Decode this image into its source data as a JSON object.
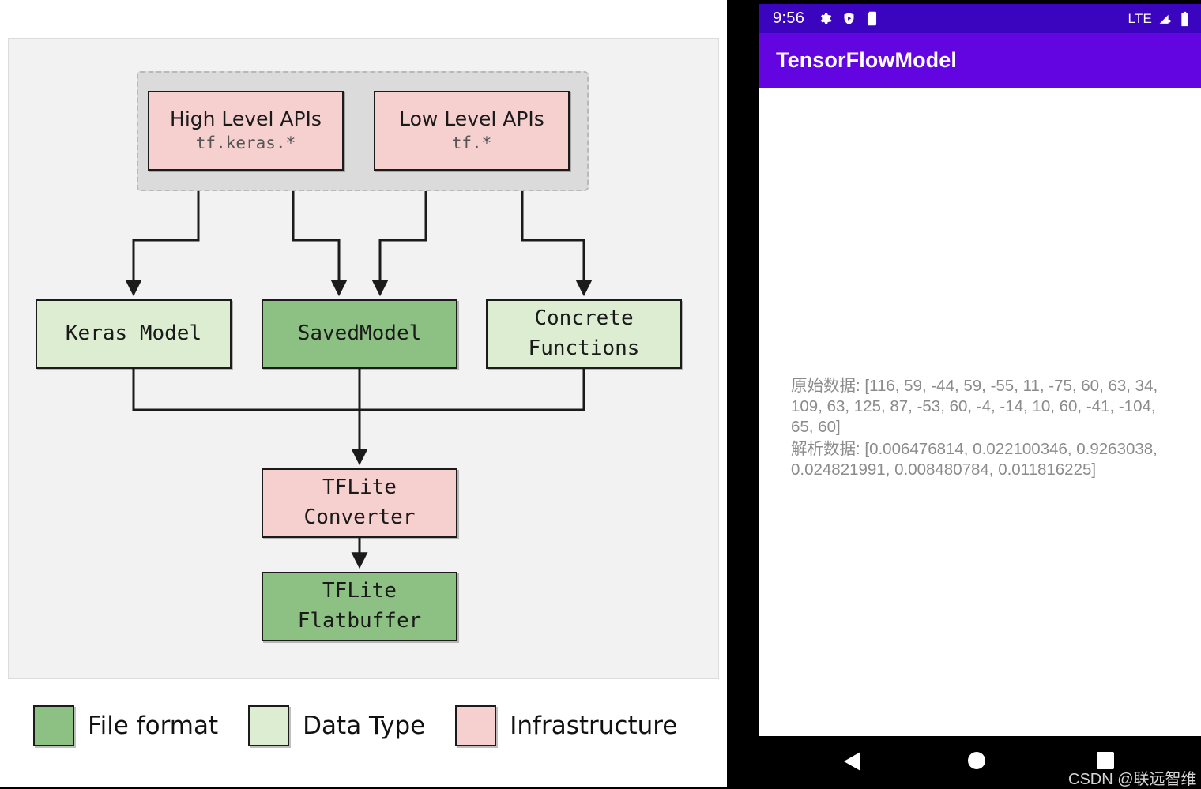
{
  "diagram": {
    "group_label": "tensorflow-apis-group",
    "colors": {
      "pink": "#f6cfcf",
      "green": "#8cc183",
      "light_green": "#dcedd2",
      "panel_bg": "#f2f2f2",
      "group_bg": "#dbdbdb",
      "stroke": "#1b1b1b"
    },
    "nodes": [
      {
        "id": "high-level-apis",
        "title": "High Level APIs",
        "subtitle": "tf.keras.*",
        "fill": "pink",
        "category": "Infrastructure"
      },
      {
        "id": "low-level-apis",
        "title": "Low Level APIs",
        "subtitle": "tf.*",
        "fill": "pink",
        "category": "Infrastructure"
      },
      {
        "id": "keras-model",
        "title": "Keras Model",
        "subtitle": "",
        "fill": "light_green",
        "category": "Data Type"
      },
      {
        "id": "saved-model",
        "title": "SavedModel",
        "subtitle": "",
        "fill": "green",
        "category": "File format"
      },
      {
        "id": "concrete-functions",
        "title": "Concrete\nFunctions",
        "title_line1": "Concrete",
        "title_line2": "Functions",
        "subtitle": "",
        "fill": "light_green",
        "category": "Data Type"
      },
      {
        "id": "tflite-converter",
        "title_line1": "TFLite",
        "title_line2": "Converter",
        "subtitle": "",
        "fill": "pink",
        "category": "Infrastructure"
      },
      {
        "id": "tflite-flatbuffer",
        "title_line1": "TFLite",
        "title_line2": "Flatbuffer",
        "subtitle": "",
        "fill": "green",
        "category": "File format"
      }
    ],
    "node_text": {
      "high_level_title": "High Level APIs",
      "high_level_sub": "tf.keras.*",
      "low_level_title": "Low Level APIs",
      "low_level_sub": "tf.*",
      "keras_model": "Keras Model",
      "saved_model": "SavedModel",
      "concrete_l1": "Concrete",
      "concrete_l2": "Functions",
      "converter_l1": "TFLite",
      "converter_l2": "Converter",
      "flatbuffer_l1": "TFLite",
      "flatbuffer_l2": "Flatbuffer"
    },
    "edges": [
      {
        "from": "high-level-apis",
        "to": "keras-model"
      },
      {
        "from": "high-level-apis",
        "to": "saved-model"
      },
      {
        "from": "low-level-apis",
        "to": "saved-model"
      },
      {
        "from": "low-level-apis",
        "to": "concrete-functions"
      },
      {
        "from": "keras-model",
        "to": "tflite-converter"
      },
      {
        "from": "saved-model",
        "to": "tflite-converter"
      },
      {
        "from": "concrete-functions",
        "to": "tflite-converter"
      },
      {
        "from": "tflite-converter",
        "to": "tflite-flatbuffer"
      }
    ],
    "legend": [
      {
        "id": "file-format",
        "label": "File format",
        "fill": "green"
      },
      {
        "id": "data-type",
        "label": "Data Type",
        "fill": "light_green"
      },
      {
        "id": "infrastructure",
        "label": "Infrastructure",
        "fill": "pink"
      }
    ]
  },
  "phone": {
    "status_bar": {
      "time": "9:56",
      "left_icons": [
        "gear-icon",
        "shield-play-icon",
        "sd-card-icon"
      ],
      "network_label": "LTE",
      "right_icons": [
        "signal-no-data-icon",
        "battery-full-icon"
      ],
      "background": "#3b05bf"
    },
    "app_bar": {
      "title": "TensorFlowModel",
      "background": "#6305e0"
    },
    "body": {
      "raw_data_line": "原始数据: [116, 59, -44, 59, -55, 11, -75, 60, 63, 34, 109, 63, 125, 87, -53, 60, -4, -14, 10, 60, -41, -104, 65, 60]",
      "parsed_data_line": "解析数据: [0.006476814, 0.022100346, 0.9263038, 0.024821991, 0.008480784, 0.011816225]",
      "text_color": "#8b8b8b"
    },
    "nav_bar": {
      "back": "back-triangle-icon",
      "home": "home-circle-icon",
      "recents": "recents-square-icon"
    },
    "watermark": "CSDN @联远智维"
  }
}
